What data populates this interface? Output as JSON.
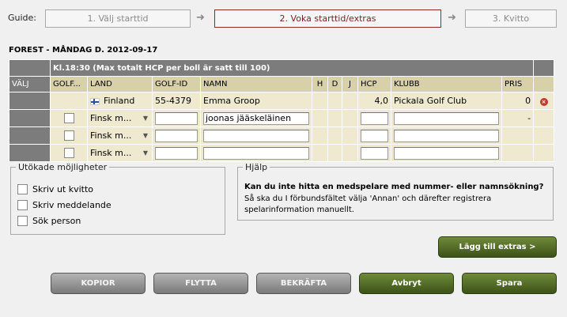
{
  "guide": {
    "label": "Guide:",
    "steps": [
      "1. Välj starttid",
      "2. Voka starttid/extras",
      "3. Kvitto"
    ],
    "arrow": "➜"
  },
  "page_title": "FOREST - MÅNDAG D. 2012-09-17",
  "table": {
    "time_header": "Kl.18:30 (Max totalt HCP per boll är satt till 100)",
    "headers": {
      "valj": "VÄLJ",
      "golf": "GOLF...",
      "land": "LAND",
      "golf_id": "GOLF-ID",
      "namn": "NAMN",
      "h": "H",
      "d": "D",
      "j": "J",
      "hcp": "HCP",
      "klubb": "KLUBB",
      "pris": "PRIS"
    },
    "rows": [
      {
        "land": "Finland",
        "golf_id": "55-4379",
        "namn": "Emma Groop",
        "hcp": "4,0",
        "klubb": "Pickala Golf Club",
        "pris": "0"
      },
      {
        "land": "Finsk m...",
        "golf_id": "",
        "namn": "joonas jääskeläinen",
        "hcp": "",
        "klubb": "",
        "pris": "-"
      },
      {
        "land": "Finsk m...",
        "golf_id": "",
        "namn": "",
        "hcp": "",
        "klubb": "",
        "pris": ""
      },
      {
        "land": "Finsk m...",
        "golf_id": "",
        "namn": "",
        "hcp": "",
        "klubb": "",
        "pris": ""
      }
    ]
  },
  "options": {
    "legend": "Utökade möjligheter",
    "items": [
      "Skriv ut kvitto",
      "Skriv meddelande",
      "Sök person"
    ]
  },
  "help": {
    "legend": "Hjälp",
    "question": "Kan du inte hitta en medspelare med nummer- eller namnsökning?",
    "text": "Så ska du I förbundsfältet välja 'Annan' och därefter registrera spelarinformation manuellt."
  },
  "buttons": {
    "extras": "Lägg till extras >",
    "kopior": "KOPIOR",
    "flytta": "FLYTTA",
    "bekrafta": "BEKRÄFTA",
    "avbryt": "Avbryt",
    "spara": "Spara"
  },
  "colors": {
    "header_dark": "#7c7c7c",
    "header_tan": "#d8d0a8",
    "row_bg": "#efe9cf",
    "active_step_border": "#8a2a2a",
    "green_button": "#4b6322"
  },
  "icons": {
    "flag": "finland-flag-icon",
    "delete": "remove-icon",
    "dropdown": "chevron-down-icon"
  }
}
